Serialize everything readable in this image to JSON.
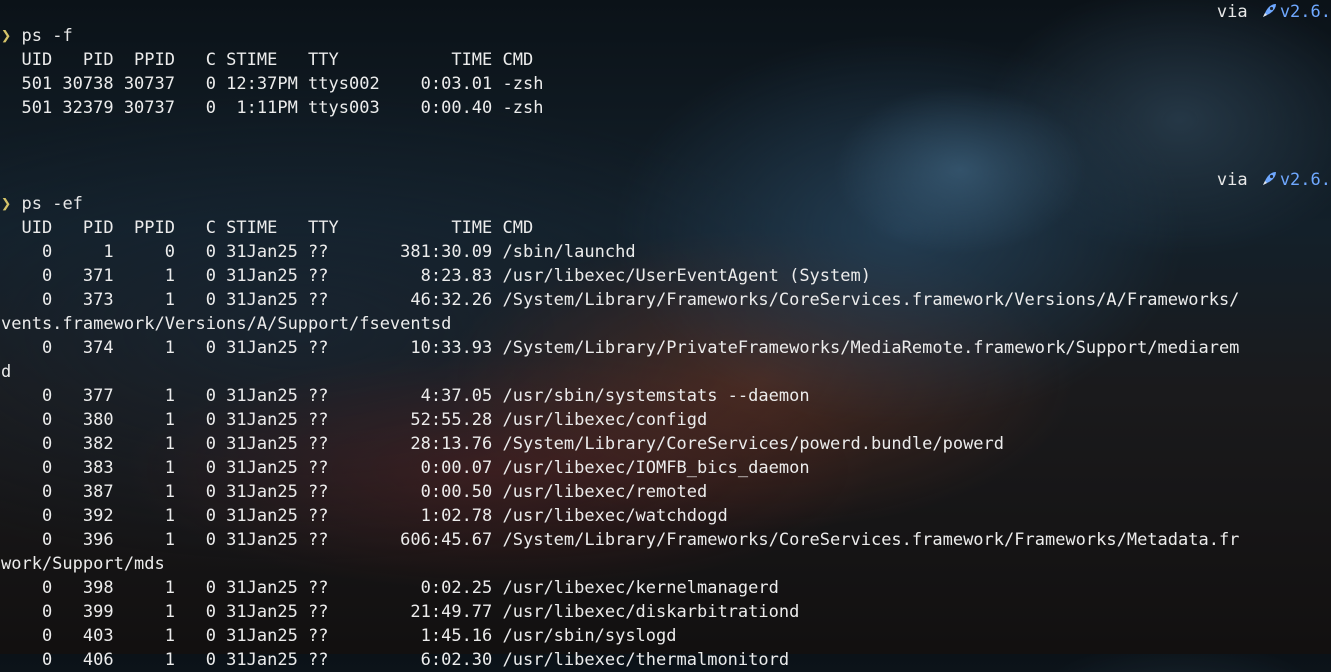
{
  "terminal": {
    "block1": {
      "tilde": "~",
      "prompt_arrow": "❯",
      "command": "ps -f",
      "via_label": "via",
      "version": "v2.6.",
      "header": "  UID   PID  PPID   C STIME   TTY           TIME CMD",
      "rows": [
        "  501 30738 30737   0 12:37PM ttys002    0:03.01 -zsh",
        "  501 32379 30737   0  1:11PM ttys003    0:00.40 -zsh"
      ]
    },
    "block2": {
      "tilde": "~",
      "prompt_arrow": "❯",
      "command": "ps -ef",
      "via_label": "via",
      "version": "v2.6.",
      "header": "  UID   PID  PPID   C STIME   TTY           TIME CMD",
      "rows": [
        "    0     1     0   0 31Jan25 ??       381:30.09 /sbin/launchd",
        "    0   371     1   0 31Jan25 ??         8:23.83 /usr/libexec/UserEventAgent (System)",
        "    0   373     1   0 31Jan25 ??        46:32.26 /System/Library/Frameworks/CoreServices.framework/Versions/A/Frameworks/",
        "vents.framework/Versions/A/Support/fseventsd",
        "    0   374     1   0 31Jan25 ??        10:33.93 /System/Library/PrivateFrameworks/MediaRemote.framework/Support/mediarem",
        "d",
        "    0   377     1   0 31Jan25 ??         4:37.05 /usr/sbin/systemstats --daemon",
        "    0   380     1   0 31Jan25 ??        52:55.28 /usr/libexec/configd",
        "    0   382     1   0 31Jan25 ??        28:13.76 /System/Library/CoreServices/powerd.bundle/powerd",
        "    0   383     1   0 31Jan25 ??         0:00.07 /usr/libexec/IOMFB_bics_daemon",
        "    0   387     1   0 31Jan25 ??         0:00.50 /usr/libexec/remoted",
        "    0   392     1   0 31Jan25 ??         1:02.78 /usr/libexec/watchdogd",
        "    0   396     1   0 31Jan25 ??       606:45.67 /System/Library/Frameworks/CoreServices.framework/Frameworks/Metadata.fr",
        "work/Support/mds",
        "    0   398     1   0 31Jan25 ??         0:02.25 /usr/libexec/kernelmanagerd",
        "    0   399     1   0 31Jan25 ??        21:49.77 /usr/libexec/diskarbitrationd",
        "    0   403     1   0 31Jan25 ??         1:45.16 /usr/sbin/syslogd",
        "    0   406     1   0 31Jan25 ??         6:02.30 /usr/libexec/thermalmonitord"
      ]
    }
  },
  "colors": {
    "prompt_arrow": "#d6c46a",
    "tilde": "#6b8fa3",
    "version": "#6fa8ff",
    "text": "#ececec"
  },
  "icons": {
    "runtime": "rocket-icon"
  }
}
